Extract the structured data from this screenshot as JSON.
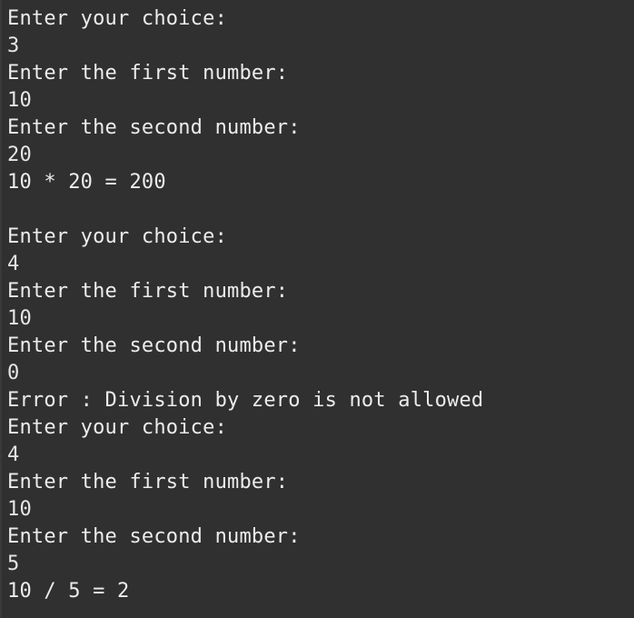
{
  "terminal": {
    "lines": [
      {
        "kind": "prompt",
        "text": "Enter your choice:"
      },
      {
        "kind": "input",
        "text": "3"
      },
      {
        "kind": "prompt",
        "text": "Enter the first number:"
      },
      {
        "kind": "input",
        "text": "10"
      },
      {
        "kind": "prompt",
        "text": "Enter the second number:"
      },
      {
        "kind": "input",
        "text": "20"
      },
      {
        "kind": "result",
        "text": "10 * 20 = 200"
      },
      {
        "kind": "blank",
        "text": ""
      },
      {
        "kind": "prompt",
        "text": "Enter your choice:"
      },
      {
        "kind": "input",
        "text": "4"
      },
      {
        "kind": "prompt",
        "text": "Enter the first number:"
      },
      {
        "kind": "input",
        "text": "10"
      },
      {
        "kind": "prompt",
        "text": "Enter the second number:"
      },
      {
        "kind": "input",
        "text": "0"
      },
      {
        "kind": "error",
        "text": "Error : Division by zero is not allowed"
      },
      {
        "kind": "prompt",
        "text": "Enter your choice:"
      },
      {
        "kind": "input",
        "text": "4"
      },
      {
        "kind": "prompt",
        "text": "Enter the first number:"
      },
      {
        "kind": "input",
        "text": "10"
      },
      {
        "kind": "prompt",
        "text": "Enter the second number:"
      },
      {
        "kind": "input",
        "text": "5"
      },
      {
        "kind": "result",
        "text": "10 / 5 = 2"
      }
    ]
  },
  "colors": {
    "background": "#303030",
    "text": "#e9e9e9"
  }
}
